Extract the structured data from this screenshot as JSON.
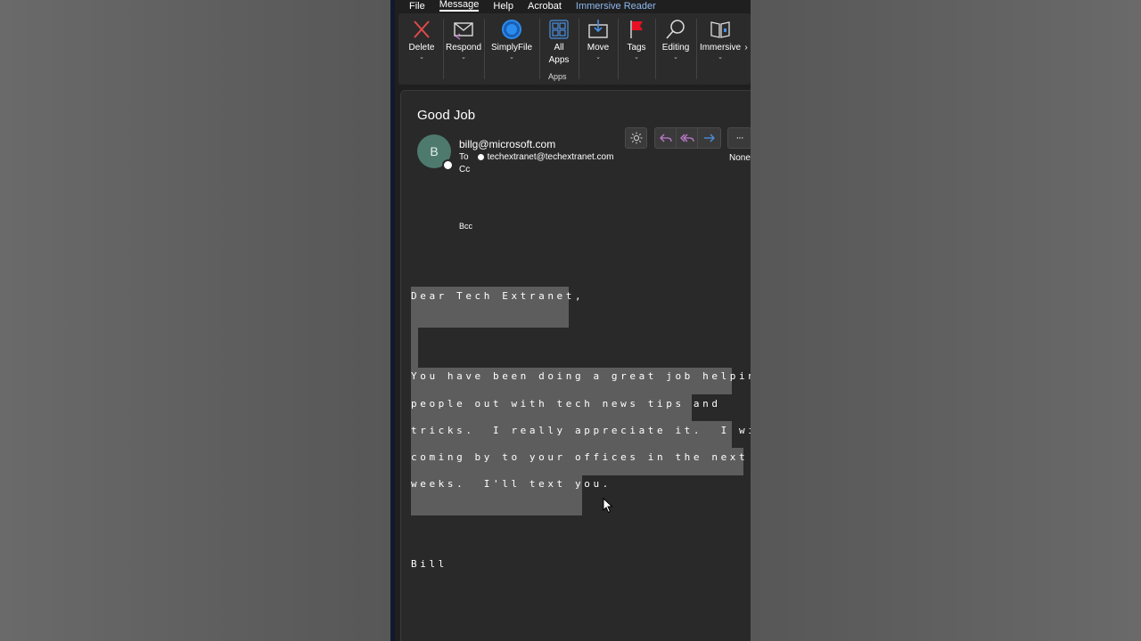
{
  "menu": {
    "items": [
      "File",
      "Message",
      "Help",
      "Acrobat",
      "Immersive Reader"
    ],
    "active": "Message"
  },
  "ribbon": {
    "delete_label": "Delete",
    "respond_label": "Respond",
    "simplyfile_label": "SimplyFile",
    "all_apps_label_1": "All",
    "all_apps_label_2": "Apps",
    "apps_group_label": "Apps",
    "move_label": "Move",
    "tags_label": "Tags",
    "editing_label": "Editing",
    "immersive_label": "Immersive",
    "chevron": "⌄",
    "more_chevron": "›"
  },
  "email": {
    "subject": "Good Job",
    "avatar_initial": "B",
    "sender": "billg@microsoft.com",
    "to_label": "To",
    "to_address": "techextranet@techextranet.com",
    "cc_label": "Cc",
    "bcc_label": "Bcc",
    "sensitivity": "None",
    "more_label": "···",
    "body": {
      "greeting": "Dear Tech Extranet,",
      "lines": [
        "You have been doing a great job helping",
        "people out with tech news tips and",
        "tricks.  I really appreciate it.  I will be",
        "coming by to your offices in the next few",
        "weeks.  I'll text you."
      ],
      "signature": "Bill"
    }
  },
  "colors": {
    "background": "#616161",
    "app": "#1f1f1f",
    "pane": "#292929",
    "highlight": "#5d5d5d",
    "accent": "#8fb8ef",
    "avatar": "#4e7a6e",
    "delete": "#e04a4a",
    "flag": "#e81123",
    "simplyfile": "#2b8cf0"
  }
}
